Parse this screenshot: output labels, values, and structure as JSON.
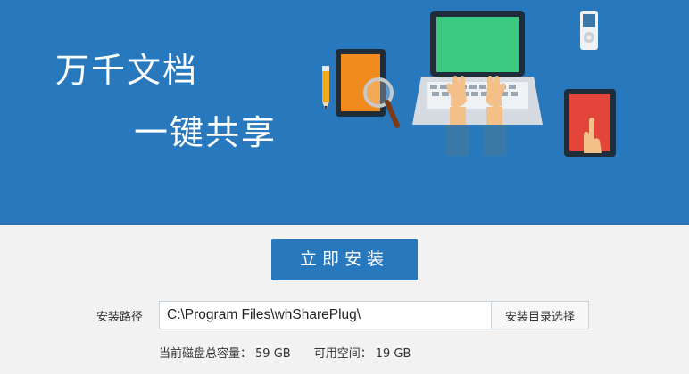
{
  "banner": {
    "slogan_line1": "万千文档",
    "slogan_line2": "一键共享",
    "background": "#2878be"
  },
  "illustration": {
    "items": [
      "pencil-icon",
      "tablet-with-magnifier-icon",
      "laptop-typing-icon",
      "music-player-icon",
      "tablet-touch-icon"
    ]
  },
  "install": {
    "button_label": "立即安装",
    "path_label": "安装路径",
    "path_value": "C:\\Program Files\\whSharePlug\\",
    "browse_label": "安装目录选择"
  },
  "disk": {
    "total_label": "当前磁盘总容量：",
    "total_value": "59 GB",
    "free_label": "可用空间：",
    "free_value": "19 GB"
  }
}
